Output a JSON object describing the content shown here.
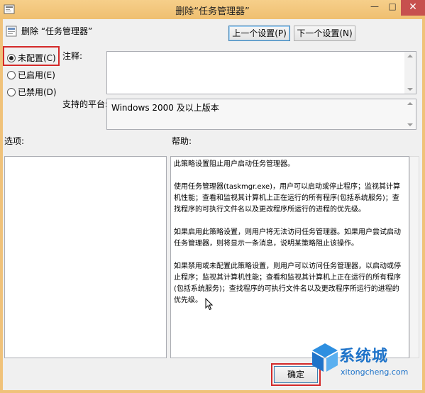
{
  "window": {
    "title": "删除“任务管理器”",
    "minimize_icon": "minimize-icon",
    "maximize_icon": "maximize-icon",
    "close_icon": "close-icon"
  },
  "header": {
    "policy_name": "删除 “任务管理器”",
    "prev_button": "上一个设置(P)",
    "next_button": "下一个设置(N)"
  },
  "state_options": [
    {
      "label": "未配置(C)",
      "selected": true
    },
    {
      "label": "已启用(E)",
      "selected": false
    },
    {
      "label": "已禁用(D)",
      "selected": false
    }
  ],
  "labels": {
    "comment": "注释:",
    "supported_platform": "支持的平台:",
    "options": "选项:",
    "help": "帮助:"
  },
  "comment_value": "",
  "supported_platform_value": "Windows 2000 及以上版本",
  "help_text": [
    "此策略设置阻止用户启动任务管理器。",
    "使用任务管理器(taskmgr.exe)，用户可以启动或停止程序；监视其计算机性能；查看和监视其计算机上正在运行的所有程序(包括系统服务)；查找程序的可执行文件名以及更改程序所运行的进程的优先级。",
    "如果启用此策略设置，则用户将无法访问任务管理器。如果用户尝试启动任务管理器，则将显示一条消息，说明某策略阻止该操作。",
    "如果禁用或未配置此策略设置，则用户可以访问任务管理器，以启动或停止程序；监视其计算机性能；查看和监视其计算机上正在运行的所有程序(包括系统服务)；查找程序的可执行文件名以及更改程序所运行的进程的优先级。"
  ],
  "footer": {
    "ok_button": "确定"
  },
  "watermark": {
    "brand": "系统城",
    "url": "xitongcheng.com"
  },
  "colors": {
    "title_bar": "#efbf70",
    "close_button": "#c7504e",
    "highlight": "#d42a2a",
    "watermark_blue": "#1e73c9"
  }
}
